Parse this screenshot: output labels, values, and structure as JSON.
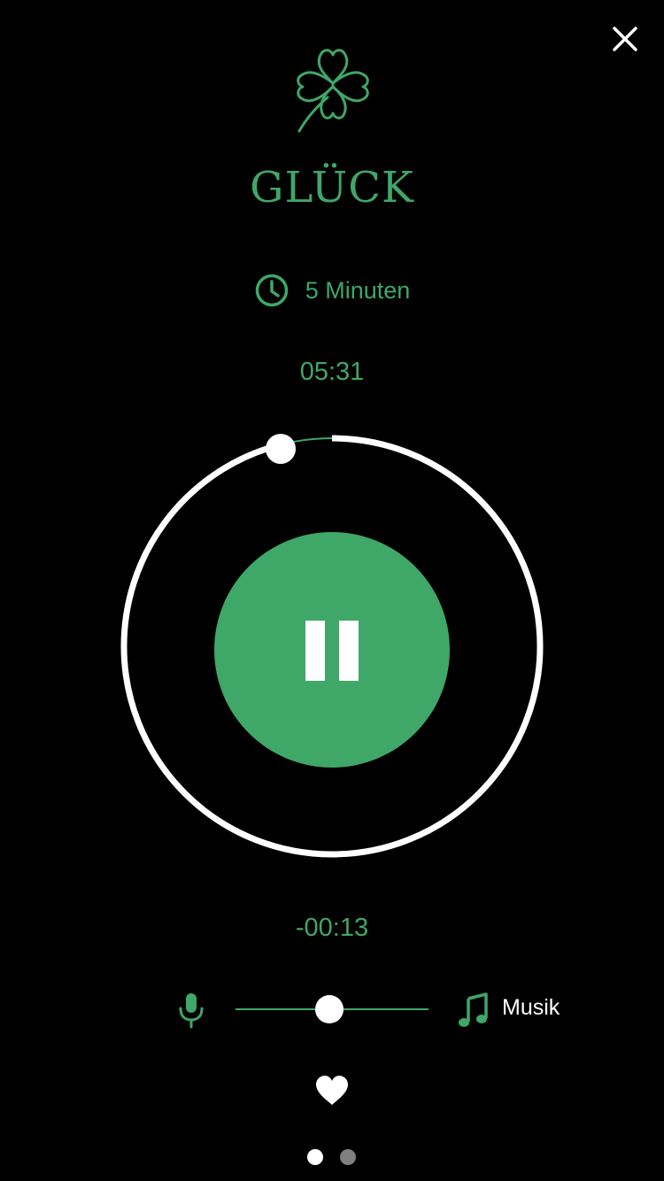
{
  "colors": {
    "background": "#000000",
    "accent": "#3fa767",
    "foreground": "#ffffff",
    "inactive_dot": "#808080"
  },
  "icons": {
    "close": "close-icon",
    "header": "four-leaf-clover-icon",
    "duration": "clock-icon",
    "voice": "microphone-icon",
    "music": "music-note-icon",
    "favorite": "heart-icon"
  },
  "session": {
    "title": "GLÜCK",
    "duration_label": "5 Minuten",
    "elapsed": "05:31",
    "remaining": "-00:13"
  },
  "player": {
    "state": "playing",
    "control": "pause",
    "ring_progress_fraction": 0.95
  },
  "mix": {
    "label": "Musik",
    "balance_fraction": 0.48
  },
  "pager": {
    "total": 2,
    "active_index": 0
  }
}
